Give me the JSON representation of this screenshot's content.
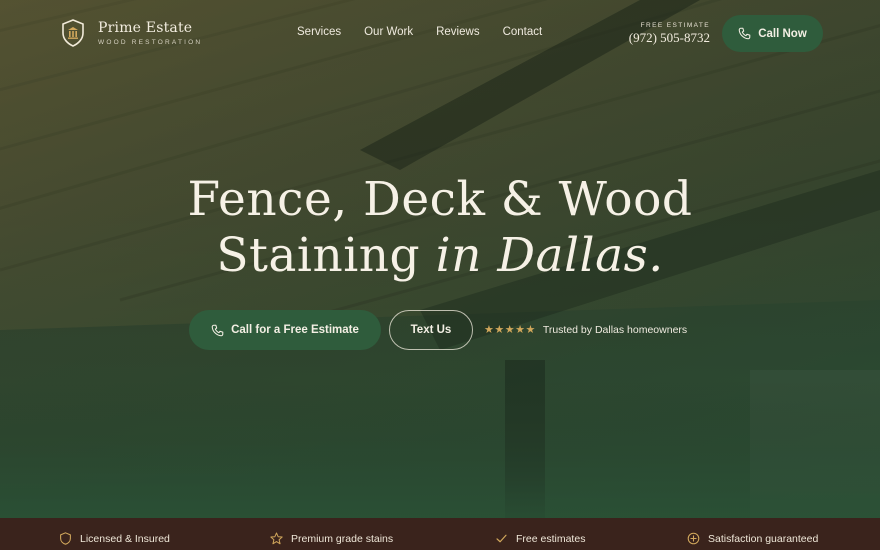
{
  "brand": {
    "name": "Prime Estate",
    "tagline": "WOOD RESTORATION"
  },
  "nav": {
    "links": [
      "Services",
      "Our Work",
      "Reviews",
      "Contact"
    ]
  },
  "phone": {
    "label": "FREE ESTIMATE",
    "number": "(972) 505-8732"
  },
  "call_button": {
    "label": "Call Now",
    "icon": "phone-icon"
  },
  "hero": {
    "line1": "Fence, Deck & Wood",
    "line2_plain": "Staining",
    "line2_italic": "in Dallas."
  },
  "cta": {
    "primary_label": "Call for a Free Estimate",
    "primary_icon": "phone-icon",
    "secondary_label": "Text Us"
  },
  "trust": {
    "stars": "★★★★★",
    "rating": 5,
    "text": "Trusted by Dallas homeowners"
  },
  "features": [
    {
      "icon": "shield-icon",
      "label": "Licensed & Insured"
    },
    {
      "icon": "star-icon",
      "label": "Premium grade stains"
    },
    {
      "icon": "check-icon",
      "label": "Free estimates"
    },
    {
      "icon": "plus-circle-icon",
      "label": "Satisfaction guaranteed"
    }
  ],
  "colors": {
    "accent_green": "#2f5c3c",
    "footer_brown": "#3a231c",
    "star_gold": "#d2a85c",
    "text_cream": "#f6f1e6"
  }
}
